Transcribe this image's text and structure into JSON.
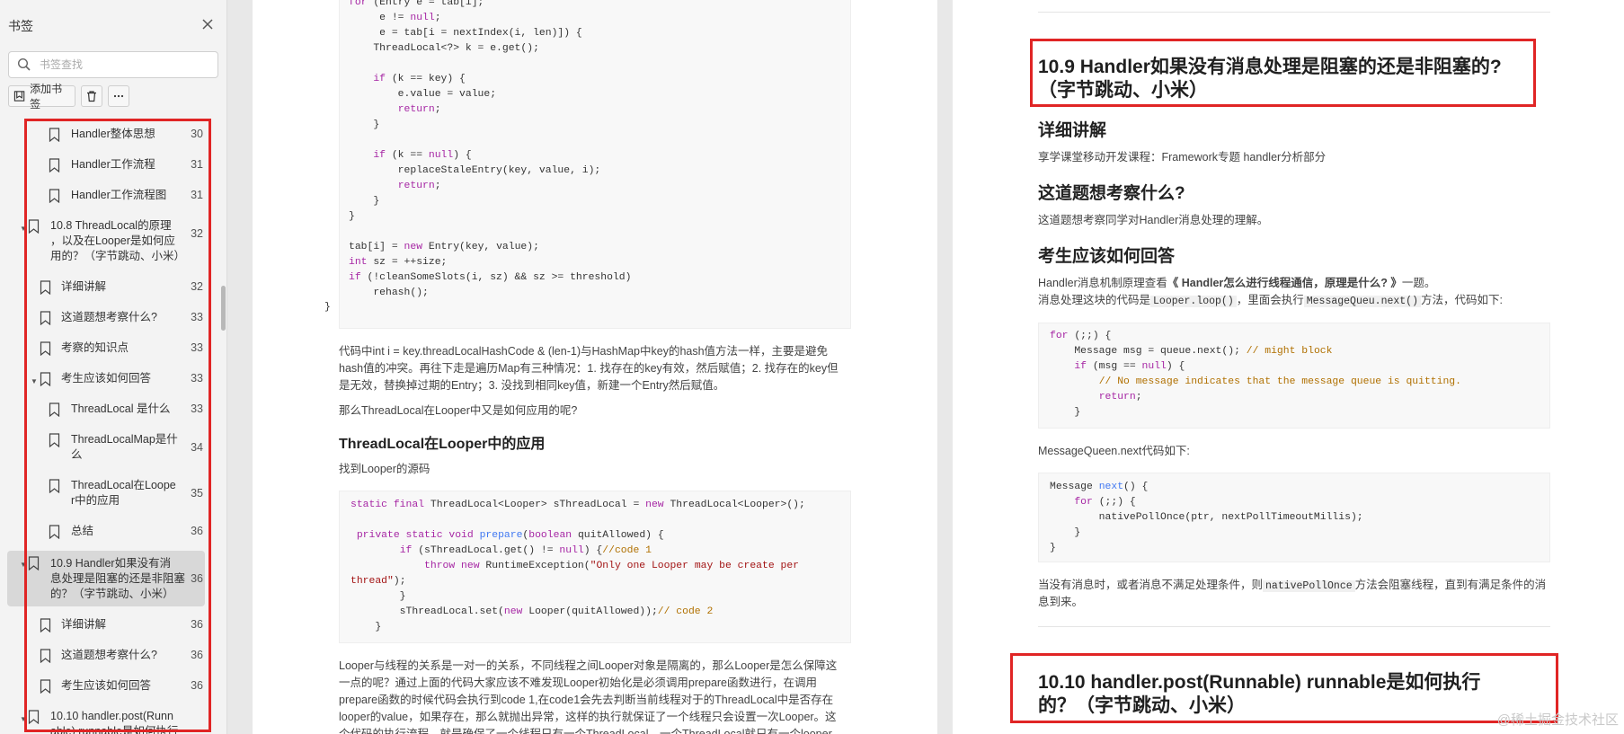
{
  "sidebar": {
    "title": "书签",
    "search_placeholder": "书签查找",
    "add_bookmark_label": "添加书签",
    "items": [
      {
        "label": "Handler整体思想",
        "page": "30"
      },
      {
        "label": "Handler工作流程",
        "page": "31"
      },
      {
        "label": "Handler工作流程图",
        "page": "31"
      },
      {
        "label1": "10.8 ThreadLocal的原理",
        "label2": "，以及在Looper是如何应",
        "label3": "用的？（字节跳动、小米）",
        "page": "32"
      },
      {
        "label": "详细讲解",
        "page": "32"
      },
      {
        "label": "这道题想考察什么?",
        "page": "33"
      },
      {
        "label": "考察的知识点",
        "page": "33"
      },
      {
        "label": "考生应该如何回答",
        "page": "33"
      },
      {
        "label": "ThreadLocal 是什么",
        "page": "33"
      },
      {
        "label1": "ThreadLocalMap是什",
        "label2": "么",
        "page": "34"
      },
      {
        "label1": "ThreadLocal在Loope",
        "label2": "r中的应用",
        "page": "35"
      },
      {
        "label": "总结",
        "page": "36"
      },
      {
        "label1": "10.9   Handler如果没有消",
        "label2": "息处理是阻塞的还是非阻塞",
        "label3": "的？（字节跳动、小米）",
        "page": "36"
      },
      {
        "label": "详细讲解",
        "page": "36"
      },
      {
        "label": "这道题想考察什么?",
        "page": "36"
      },
      {
        "label": "考生应该如何回答",
        "page": "36"
      },
      {
        "label1": "10.10 handler.post(Runn",
        "label2": "able) runnable是如何执行",
        "page": ""
      }
    ]
  },
  "left_page": {
    "code1": [
      "for (Entry e = tab[i];",
      "     e != null;",
      "     e = tab[i = nextIndex(i, len)]) {",
      "    ThreadLocal<?> k = e.get();",
      "",
      "    if (k == key) {",
      "        e.value = value;",
      "        return;",
      "    }",
      "",
      "    if (k == null) {",
      "        replaceStaleEntry(key, value, i);",
      "        return;",
      "    }",
      "}",
      "",
      "tab[i] = new Entry(key, value);",
      "int sz = ++size;",
      "if (!cleanSomeSlots(i, sz) && sz >= threshold)",
      "    rehash();",
      "}"
    ],
    "para1_l1": "代码中int i = key.threadLocalHashCode & (len-1)与HashMap中key的hash值方法一样，主要是避免",
    "para1_l2": "hash值的冲突。再往下走是遍历Map有三种情况：1. 找存在的key有效，然后赋值；2. 找存在的key但",
    "para1_l3": "是无效，替换掉过期的Entry；3. 没找到相同key值，新建一个Entry然后赋值。",
    "para2": "那么ThreadLocal在Looper中又是如何应用的呢?",
    "heading": "ThreadLocal在Looper中的应用",
    "para3": "找到Looper的源码",
    "code2": [
      "static final ThreadLocal<Looper> sThreadLocal = new ThreadLocal<Looper>();",
      "",
      " private static void prepare(boolean quitAllowed) {",
      "        if (sThreadLocal.get() != null) {//code 1",
      "            throw new RuntimeException(\"Only one Looper may be create per",
      "thread\");",
      "        }",
      "        sThreadLocal.set(new Looper(quitAllowed));// code 2",
      "    }"
    ],
    "para4_l1": "Looper与线程的关系是一对一的关系，不同线程之间Looper对象是隔离的，那么Looper是怎么保障这",
    "para4_l2": "一点的呢？通过上面的代码大家应该不难发现Looper初始化是必须调用prepare函数进行，在调用",
    "para4_l3": "prepare函数的时候代码会执行到code 1,在code1会先去判断当前线程对于的ThreadLocal中是否存在",
    "para4_l4": "looper的value，如果存在，那么就抛出异常，这样的执行就保证了一个线程只会设置一次Looper。这",
    "para4_l5": "个代码的执行流程，就是确保了一个线程只有一个ThreadLocal，一个ThreadLocal就只有一个looper"
  },
  "right_page": {
    "title_l1": "10.9 Handler如果没有消息处理是阻塞的还是非阻塞的?",
    "title_l2": "（字节跳动、小米）",
    "h_detail": "详细讲解",
    "detail_text": "享学课堂移动开发课程：Framework专题 handler分析部分",
    "h_purpose": "这道题想考察什么?",
    "purpose_text": "这道题想考察同学对Handler消息处理的理解。",
    "h_answer": "考生应该如何回答",
    "answer_l1_a": "Handler消息机制原理查看",
    "answer_l1_b": "《 Handler怎么进行线程通信，原理是什么? 》",
    "answer_l1_c": "一题。",
    "answer_l2_a": "消息处理这块的代码是",
    "answer_l2_code1": "Looper.loop()",
    "answer_l2_b": "，里面会执行",
    "answer_l2_code2": "MessageQueu.next()",
    "answer_l2_c": "方法，代码如下:",
    "code1": [
      "for (;;) {",
      "    Message msg = queue.next(); // might block",
      "    if (msg == null) {",
      "        // No message indicates that the message queue is quitting.",
      "        return;",
      "    }"
    ],
    "next_text": "MessageQueen.next代码如下:",
    "code2": [
      "Message next() {",
      "    for (;;) {",
      "        nativePollOnce(ptr, nextPollTimeoutMillis);",
      "    }",
      "}"
    ],
    "end_l1_a": "当没有消息时，或者消息不满足处理条件，则",
    "end_l1_code": "nativePollOnce",
    "end_l1_b": "方法会阻塞线程，直到有满足条件的消",
    "end_l2": "息到来。",
    "next_title_l1": "10.10 handler.post(Runnable) runnable是如何执行",
    "next_title_l2": "的？（字节跳动、小米）",
    "watermark": "@稀土掘金技术社区"
  },
  "colors": {
    "highlight_border": "#e02525",
    "sidebar_bg": "#f3f3f3",
    "active_item": "#d8d8d8"
  }
}
